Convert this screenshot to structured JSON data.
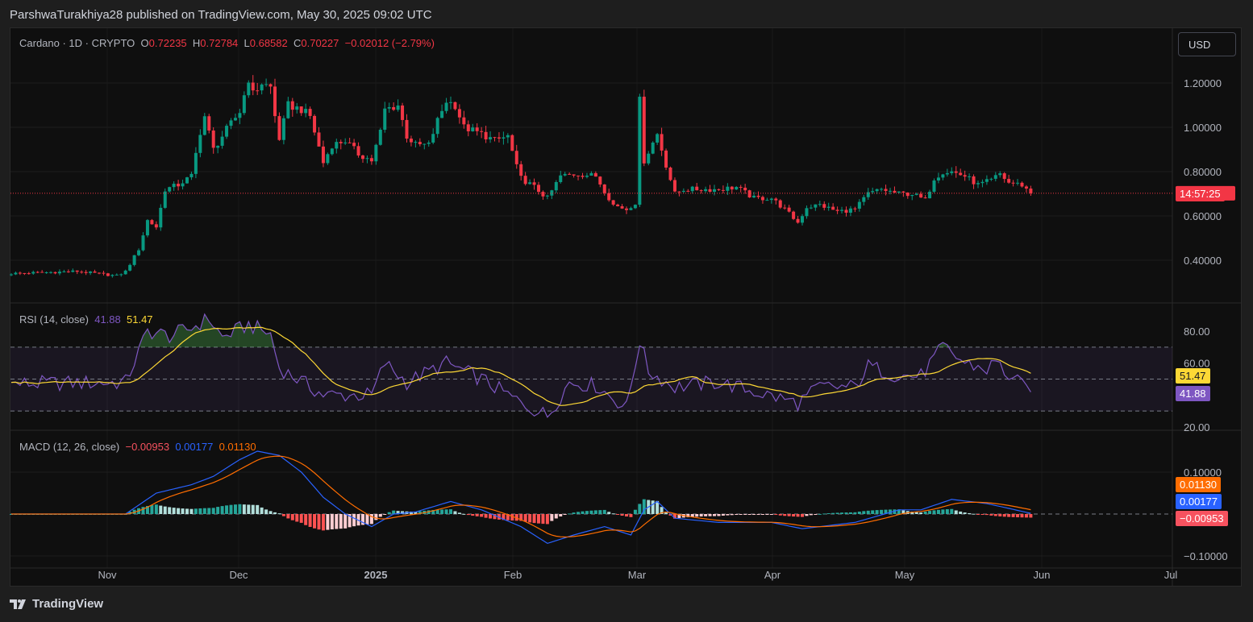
{
  "header": {
    "published": "ParshwaTurakhiya28 published on TradingView.com, May 30, 2025 09:02 UTC"
  },
  "symbol": {
    "name": "Cardano · 1D · CRYPTO",
    "o_label": "O",
    "o": "0.72235",
    "h_label": "H",
    "h": "0.72784",
    "l_label": "L",
    "l": "0.68582",
    "c_label": "C",
    "c": "0.70227",
    "change": "−0.02012 (−2.79%)"
  },
  "currency": "USD",
  "current_price_timer": "14:57:25",
  "rsi_legend": {
    "label": "RSI (14, close)",
    "rsi": "41.88",
    "ma": "51.47"
  },
  "macd_legend": {
    "label": "MACD (12, 26, close)",
    "hist": "−0.00953",
    "macd": "0.00177",
    "signal": "0.01130"
  },
  "footer": {
    "brand": "TradingView"
  },
  "colors": {
    "up": "#089981",
    "down": "#f23645",
    "rsi": "#7e57c2",
    "rsi_ma": "#fdd835",
    "macd": "#2962ff",
    "signal": "#ff6d00"
  },
  "chart_data": [
    {
      "type": "candlestick",
      "title": "Cardano · 1D · CRYPTO",
      "start_date": "2024-10-10",
      "ylim": [
        0.3,
        1.35
      ],
      "yticks": [
        "1.20000",
        "1.00000",
        "0.80000",
        "0.60000",
        "0.40000"
      ],
      "xticks": [
        "Nov",
        "Dec",
        "2025",
        "Feb",
        "Mar",
        "Apr",
        "May",
        "Jun",
        "Jul"
      ],
      "current_price": 0.70227,
      "close_anchors": [
        [
          "2024-10-10",
          0.34
        ],
        [
          "2024-10-25",
          0.35
        ],
        [
          "2024-11-03",
          0.33
        ],
        [
          "2024-11-05",
          0.35
        ],
        [
          "2024-11-08",
          0.45
        ],
        [
          "2024-11-10",
          0.58
        ],
        [
          "2024-11-12",
          0.55
        ],
        [
          "2024-11-14",
          0.72
        ],
        [
          "2024-11-17",
          0.74
        ],
        [
          "2024-11-20",
          0.78
        ],
        [
          "2024-11-22",
          0.98
        ],
        [
          "2024-11-23",
          1.05
        ],
        [
          "2024-11-25",
          0.9
        ],
        [
          "2024-11-28",
          0.99
        ],
        [
          "2024-12-01",
          1.07
        ],
        [
          "2024-12-03",
          1.22
        ],
        [
          "2024-12-04",
          1.15
        ],
        [
          "2024-12-06",
          1.2
        ],
        [
          "2024-12-08",
          1.18
        ],
        [
          "2024-12-09",
          1.05
        ],
        [
          "2024-12-10",
          0.95
        ],
        [
          "2024-12-12",
          1.1
        ],
        [
          "2024-12-15",
          1.08
        ],
        [
          "2024-12-17",
          1.05
        ],
        [
          "2024-12-19",
          0.91
        ],
        [
          "2024-12-20",
          0.84
        ],
        [
          "2024-12-22",
          0.92
        ],
        [
          "2024-12-25",
          0.94
        ],
        [
          "2024-12-28",
          0.88
        ],
        [
          "2024-12-31",
          0.85
        ],
        [
          "2025-01-02",
          0.98
        ],
        [
          "2025-01-03",
          1.08
        ],
        [
          "2025-01-06",
          1.1
        ],
        [
          "2025-01-08",
          0.96
        ],
        [
          "2025-01-10",
          0.92
        ],
        [
          "2025-01-13",
          0.92
        ],
        [
          "2025-01-15",
          1.03
        ],
        [
          "2025-01-17",
          1.12
        ],
        [
          "2025-01-19",
          1.1
        ],
        [
          "2025-01-21",
          1.0
        ],
        [
          "2025-01-25",
          0.97
        ],
        [
          "2025-01-28",
          0.94
        ],
        [
          "2025-01-31",
          0.96
        ],
        [
          "2025-02-02",
          0.82
        ],
        [
          "2025-02-03",
          0.77
        ],
        [
          "2025-02-06",
          0.73
        ],
        [
          "2025-02-09",
          0.68
        ],
        [
          "2025-02-12",
          0.78
        ],
        [
          "2025-02-16",
          0.79
        ],
        [
          "2025-02-20",
          0.78
        ],
        [
          "2025-02-24",
          0.65
        ],
        [
          "2025-02-27",
          0.63
        ],
        [
          "2025-03-01",
          0.66
        ],
        [
          "2025-03-02",
          1.12
        ],
        [
          "2025-03-03",
          0.85
        ],
        [
          "2025-03-06",
          0.97
        ],
        [
          "2025-03-08",
          0.83
        ],
        [
          "2025-03-10",
          0.7
        ],
        [
          "2025-03-12",
          0.72
        ],
        [
          "2025-03-16",
          0.72
        ],
        [
          "2025-03-20",
          0.72
        ],
        [
          "2025-03-24",
          0.73
        ],
        [
          "2025-03-28",
          0.68
        ],
        [
          "2025-04-01",
          0.68
        ],
        [
          "2025-04-04",
          0.63
        ],
        [
          "2025-04-07",
          0.57
        ],
        [
          "2025-04-09",
          0.64
        ],
        [
          "2025-04-12",
          0.65
        ],
        [
          "2025-04-16",
          0.62
        ],
        [
          "2025-04-20",
          0.63
        ],
        [
          "2025-04-23",
          0.7
        ],
        [
          "2025-04-26",
          0.72
        ],
        [
          "2025-04-30",
          0.7
        ],
        [
          "2025-05-03",
          0.7
        ],
        [
          "2025-05-06",
          0.67
        ],
        [
          "2025-05-08",
          0.77
        ],
        [
          "2025-05-10",
          0.8
        ],
        [
          "2025-05-12",
          0.8
        ],
        [
          "2025-05-15",
          0.78
        ],
        [
          "2025-05-18",
          0.74
        ],
        [
          "2025-05-21",
          0.76
        ],
        [
          "2025-05-23",
          0.79
        ],
        [
          "2025-05-25",
          0.75
        ],
        [
          "2025-05-28",
          0.74
        ],
        [
          "2025-05-30",
          0.70227
        ]
      ]
    },
    {
      "type": "line",
      "title": "RSI (14, close)",
      "ylim": [
        15,
        90
      ],
      "yticks": [
        "80.00",
        "60.00",
        "20.00"
      ],
      "bands": [
        70,
        50,
        30
      ],
      "rsi_anchors": [
        [
          "2024-10-10",
          47
        ],
        [
          "2024-11-05",
          48
        ],
        [
          "2024-11-10",
          80
        ],
        [
          "2024-11-15",
          77
        ],
        [
          "2024-11-20",
          82
        ],
        [
          "2024-11-24",
          88
        ],
        [
          "2024-11-27",
          76
        ],
        [
          "2024-12-03",
          84
        ],
        [
          "2024-12-08",
          78
        ],
        [
          "2024-12-10",
          57
        ],
        [
          "2024-12-20",
          40
        ],
        [
          "2024-12-31",
          40
        ],
        [
          "2025-01-03",
          60
        ],
        [
          "2025-01-08",
          48
        ],
        [
          "2025-01-17",
          60
        ],
        [
          "2025-01-25",
          50
        ],
        [
          "2025-02-03",
          35
        ],
        [
          "2025-02-09",
          27
        ],
        [
          "2025-02-14",
          48
        ],
        [
          "2025-02-20",
          46
        ],
        [
          "2025-02-27",
          32
        ],
        [
          "2025-03-02",
          74
        ],
        [
          "2025-03-04",
          55
        ],
        [
          "2025-03-10",
          45
        ],
        [
          "2025-03-20",
          48
        ],
        [
          "2025-04-07",
          35
        ],
        [
          "2025-04-12",
          45
        ],
        [
          "2025-04-20",
          45
        ],
        [
          "2025-04-23",
          58
        ],
        [
          "2025-04-30",
          52
        ],
        [
          "2025-05-05",
          52
        ],
        [
          "2025-05-10",
          70
        ],
        [
          "2025-05-15",
          60
        ],
        [
          "2025-05-20",
          56
        ],
        [
          "2025-05-22",
          61
        ],
        [
          "2025-05-25",
          52
        ],
        [
          "2025-05-30",
          41.88
        ]
      ],
      "rsi_last": 41.88,
      "ma_last": 51.47
    },
    {
      "type": "line",
      "title": "MACD (12, 26, close)",
      "ylim": [
        -0.1,
        0.1
      ],
      "yticks": [
        "0.10000",
        "-0.10000"
      ],
      "macd_anchors": [
        [
          "2024-10-10",
          0
        ],
        [
          "2024-11-05",
          0
        ],
        [
          "2024-11-12",
          0.05
        ],
        [
          "2024-11-20",
          0.07
        ],
        [
          "2024-11-25",
          0.09
        ],
        [
          "2024-12-01",
          0.13
        ],
        [
          "2024-12-05",
          0.15
        ],
        [
          "2024-12-10",
          0.14
        ],
        [
          "2024-12-15",
          0.1
        ],
        [
          "2024-12-20",
          0.04
        ],
        [
          "2024-12-25",
          0.0
        ],
        [
          "2024-12-31",
          -0.03
        ],
        [
          "2025-01-05",
          0.0
        ],
        [
          "2025-01-10",
          0.005
        ],
        [
          "2025-01-18",
          0.03
        ],
        [
          "2025-01-25",
          0.01
        ],
        [
          "2025-02-03",
          -0.03
        ],
        [
          "2025-02-09",
          -0.07
        ],
        [
          "2025-02-15",
          -0.05
        ],
        [
          "2025-02-22",
          -0.03
        ],
        [
          "2025-02-28",
          -0.05
        ],
        [
          "2025-03-03",
          0.01
        ],
        [
          "2025-03-06",
          0.03
        ],
        [
          "2025-03-10",
          -0.01
        ],
        [
          "2025-03-20",
          -0.02
        ],
        [
          "2025-04-01",
          -0.02
        ],
        [
          "2025-04-08",
          -0.035
        ],
        [
          "2025-04-20",
          -0.02
        ],
        [
          "2025-04-30",
          0.01
        ],
        [
          "2025-05-05",
          0.01
        ],
        [
          "2025-05-12",
          0.035
        ],
        [
          "2025-05-20",
          0.025
        ],
        [
          "2025-05-30",
          0.00177
        ]
      ],
      "macd_last": 0.00177,
      "signal_last": 0.0113,
      "hist_last": -0.00953
    }
  ]
}
